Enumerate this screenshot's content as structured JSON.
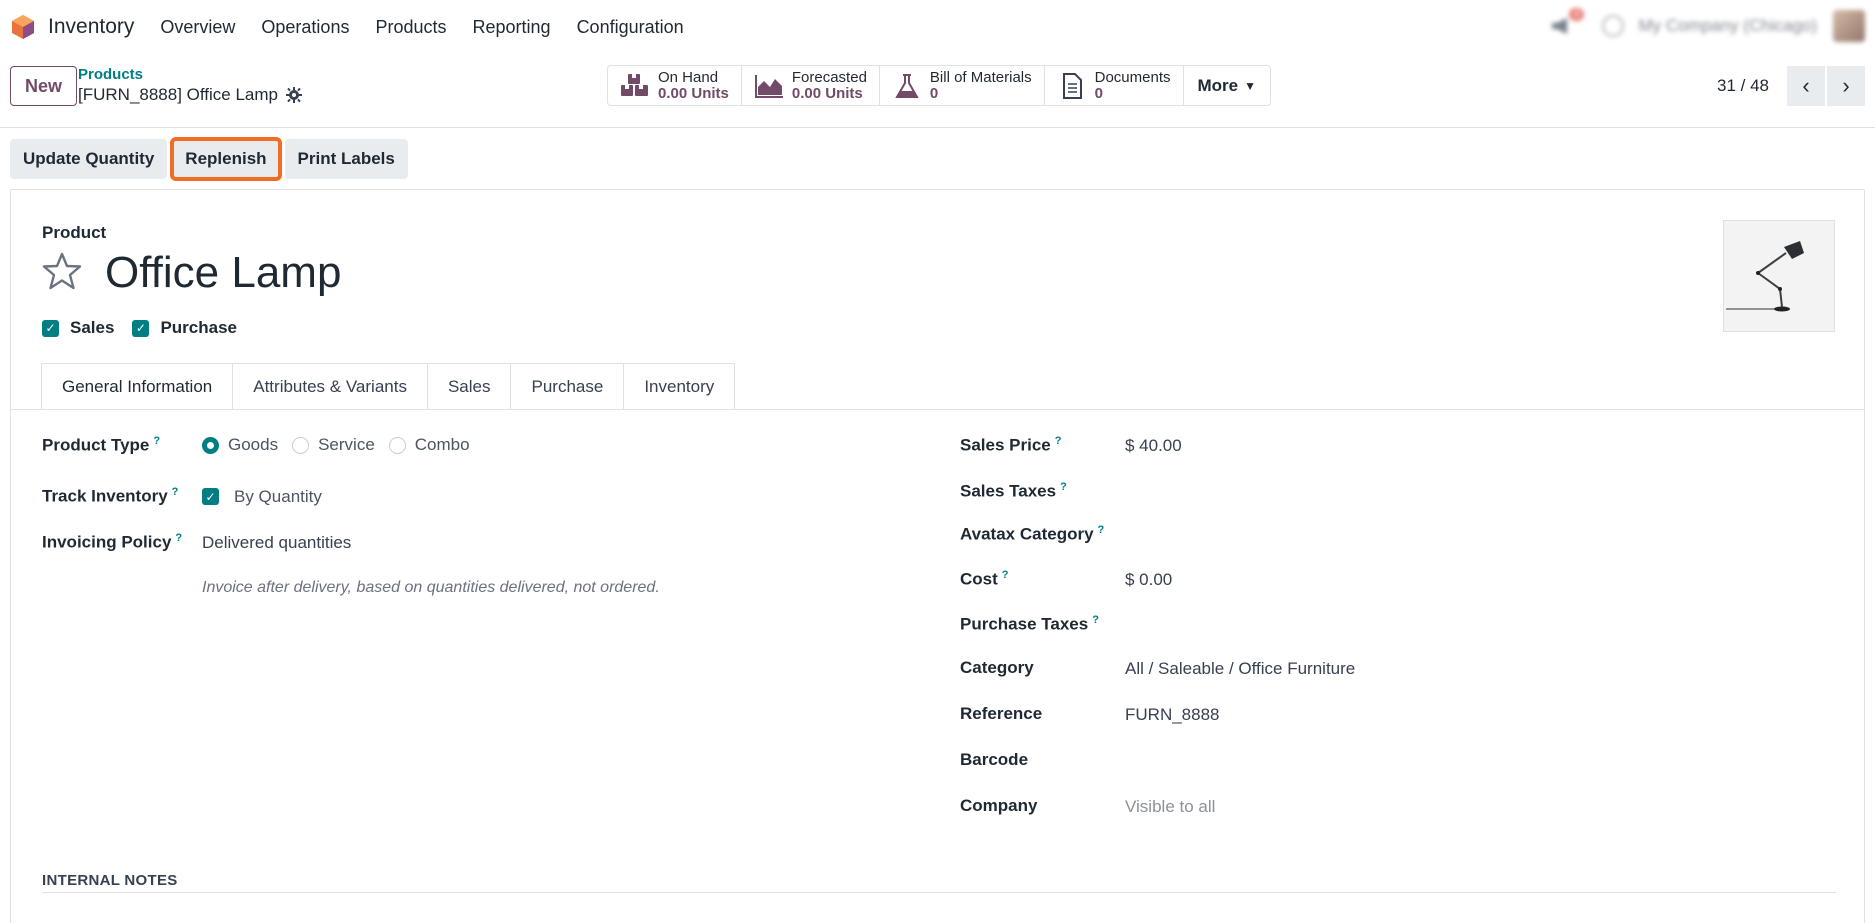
{
  "app": {
    "name": "Inventory"
  },
  "menu": [
    "Overview",
    "Operations",
    "Products",
    "Reporting",
    "Configuration"
  ],
  "nav_right": {
    "notification_count": "4",
    "company": "My Company (Chicago)"
  },
  "control": {
    "new_label": "New",
    "breadcrumb_parent": "Products",
    "breadcrumb_current": "[FURN_8888] Office Lamp",
    "stats": [
      {
        "label": "On Hand",
        "value": "0.00 Units",
        "icon": "boxes-icon"
      },
      {
        "label": "Forecasted",
        "value": "0.00 Units",
        "icon": "area-chart-icon"
      },
      {
        "label": "Bill of Materials",
        "value": "0",
        "icon": "flask-icon"
      },
      {
        "label": "Documents",
        "value": "0",
        "icon": "document-icon"
      }
    ],
    "more_label": "More",
    "pager": "31 / 48"
  },
  "actions": [
    "Update Quantity",
    "Replenish",
    "Print Labels"
  ],
  "colors": {
    "accent": "#714b67",
    "teal": "#017e84",
    "highlight": "#f26d21"
  },
  "form": {
    "product_label": "Product",
    "product_name": "Office Lamp",
    "checks": [
      "Sales",
      "Purchase"
    ],
    "tabs": [
      "General Information",
      "Attributes & Variants",
      "Sales",
      "Purchase",
      "Inventory"
    ],
    "left": {
      "product_type_label": "Product Type",
      "product_type_options": [
        "Goods",
        "Service",
        "Combo"
      ],
      "product_type_selected": "Goods",
      "track_inventory_label": "Track Inventory",
      "track_inventory_value": "By Quantity",
      "invoicing_policy_label": "Invoicing Policy",
      "invoicing_policy_value": "Delivered quantities",
      "invoicing_note": "Invoice after delivery, based on quantities delivered, not ordered."
    },
    "right": {
      "sales_price_label": "Sales Price",
      "sales_price": "$ 40.00",
      "sales_taxes_label": "Sales Taxes",
      "avatax_label": "Avatax Category",
      "cost_label": "Cost",
      "cost": "$ 0.00",
      "purchase_taxes_label": "Purchase Taxes",
      "category_label": "Category",
      "category": "All / Saleable / Office Furniture",
      "reference_label": "Reference",
      "reference": "FURN_8888",
      "barcode_label": "Barcode",
      "company_label": "Company",
      "company": "Visible to all"
    },
    "help_mark": "?",
    "notes_title": "INTERNAL NOTES"
  }
}
